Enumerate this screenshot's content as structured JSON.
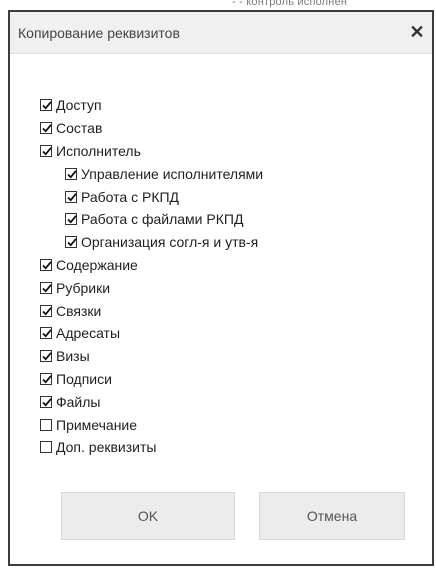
{
  "background": {
    "text": "- - контроль исполнен"
  },
  "dialog": {
    "title": "Копирование реквизитов",
    "close_icon": "close-icon",
    "close_glyph": "✕",
    "items": [
      {
        "label": "Доступ",
        "checked": true,
        "level": 0
      },
      {
        "label": "Состав",
        "checked": true,
        "level": 0
      },
      {
        "label": "Исполнитель",
        "checked": true,
        "level": 0
      },
      {
        "label": "Управление исполнителями",
        "checked": true,
        "level": 1
      },
      {
        "label": "Работа с РКПД",
        "checked": true,
        "level": 1
      },
      {
        "label": "Работа с файлами РКПД",
        "checked": true,
        "level": 1
      },
      {
        "label": "Организация согл-я и утв-я",
        "checked": true,
        "level": 1
      },
      {
        "label": "Содержание",
        "checked": true,
        "level": 0
      },
      {
        "label": "Рубрики",
        "checked": true,
        "level": 0
      },
      {
        "label": "Связки",
        "checked": true,
        "level": 0
      },
      {
        "label": "Адресаты",
        "checked": true,
        "level": 0
      },
      {
        "label": "Визы",
        "checked": true,
        "level": 0
      },
      {
        "label": "Подписи",
        "checked": true,
        "level": 0
      },
      {
        "label": "Файлы",
        "checked": true,
        "level": 0
      },
      {
        "label": "Примечание",
        "checked": false,
        "level": 0
      },
      {
        "label": "Доп. реквизиты",
        "checked": false,
        "level": 0
      }
    ],
    "ok_label": "OK",
    "cancel_label": "Отмена"
  },
  "colors": {
    "titlebar": "#f0f0f0",
    "border": "#3c3c3c",
    "button_bg": "#ececec"
  }
}
